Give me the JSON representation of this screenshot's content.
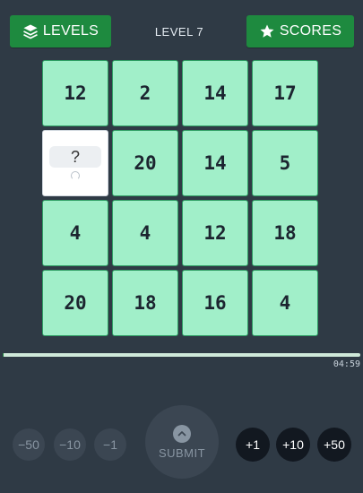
{
  "header": {
    "levels_label": "LEVELS",
    "level_text": "LEVEL 7",
    "scores_label": "SCORES"
  },
  "board": {
    "tiles": [
      "12",
      "2",
      "14",
      "17",
      "?",
      "20",
      "14",
      "5",
      "4",
      "4",
      "12",
      "18",
      "20",
      "18",
      "16",
      "4"
    ]
  },
  "timer": {
    "remaining": "04:59",
    "progress": 0.998
  },
  "controls": {
    "minus50": "−50",
    "minus10": "−10",
    "minus1": "−1",
    "submit": "SUBMIT",
    "plus1": "+1",
    "plus10": "+10",
    "plus50": "+50"
  },
  "colors": {
    "background": "#2f3a45",
    "tile": "#a1efc9",
    "accent": "#1e8a3f"
  }
}
